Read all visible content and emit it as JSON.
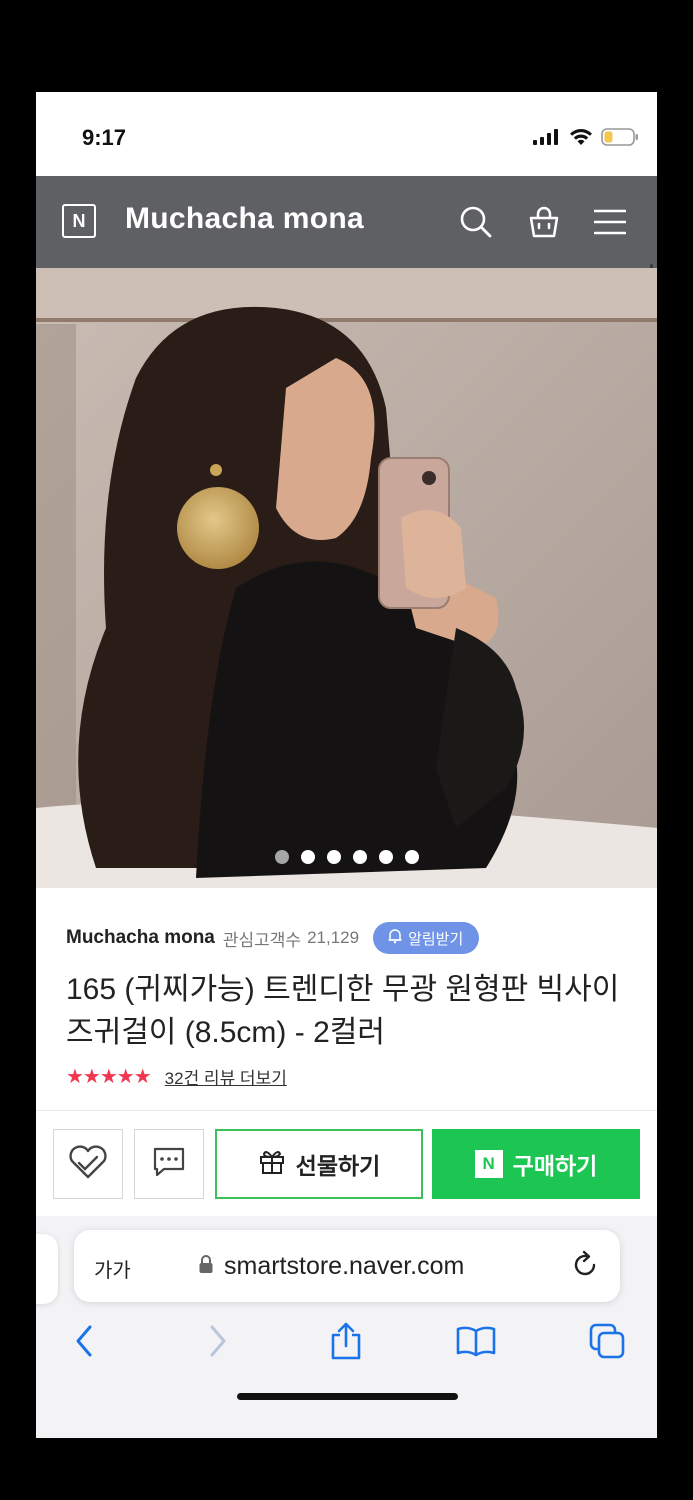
{
  "status_bar": {
    "time": "9:17",
    "icons": [
      "signal-icon",
      "wifi-icon",
      "battery-icon"
    ]
  },
  "header": {
    "logo_letter": "N",
    "store_title": "Muchacha mona",
    "icons": [
      "search-icon",
      "cart-icon",
      "menu-icon"
    ]
  },
  "gallery": {
    "image_count": 6,
    "active_index": 0
  },
  "product": {
    "store_name": "Muchacha mona",
    "follower_label": "관심고객수",
    "follower_count": "21,129",
    "notify_label": "알림받기",
    "title": "165 (귀찌가능) 트렌디한 무광 원형판 빅사이즈귀걸이 (8.5cm) - 2컬러",
    "rating_stars": 4.5,
    "stars_display": "★★★★★",
    "review_link": "32건 리뷰 더보기"
  },
  "actions": {
    "gift_label": "선물하기",
    "buy_logo": "N",
    "buy_label": "구매하기"
  },
  "browser": {
    "text_size_label": "가가",
    "url": "smartstore.naver.com"
  },
  "colors": {
    "header_bg": "#5f6063",
    "buy_green": "#1dc653",
    "notify_blue": "#6f93e6",
    "star_red": "#f0374f",
    "ios_blue": "#1a73e8"
  }
}
